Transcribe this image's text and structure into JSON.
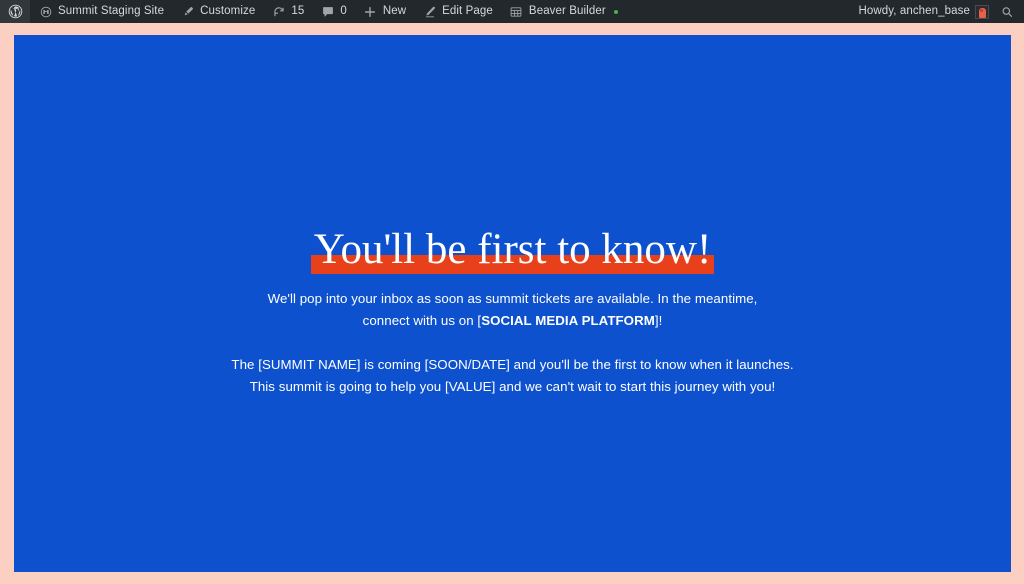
{
  "colors": {
    "page_background": "#fbcfc2",
    "canvas_blue": "#0d51ce",
    "highlight_orange": "#e8401a",
    "adminbar_background": "#23282d",
    "adminbar_text": "#d4d9dd",
    "text_white": "#ffffff",
    "bb_dot_green": "#4caf50"
  },
  "adminbar": {
    "left_items": [
      {
        "id": "wp-logo",
        "label": "",
        "icon": "wordpress-logo-icon"
      },
      {
        "id": "site-name",
        "label": "Summit Staging Site",
        "icon": "site-home-icon"
      },
      {
        "id": "customize",
        "label": "Customize",
        "icon": "paintbrush-icon"
      },
      {
        "id": "updates",
        "label": "15",
        "icon": "update-arrows-icon"
      },
      {
        "id": "comments",
        "label": "0",
        "icon": "comment-bubble-icon"
      },
      {
        "id": "new-content",
        "label": "New",
        "icon": "plus-icon"
      },
      {
        "id": "edit-page",
        "label": "Edit Page",
        "icon": "pencil-icon"
      },
      {
        "id": "beaver-builder",
        "label": "Beaver Builder",
        "icon": "grid-icon"
      }
    ],
    "right_items": [
      {
        "id": "my-account",
        "label": "Howdy, anchen_base",
        "icon": "user-avatar-icon"
      },
      {
        "id": "search",
        "label": "",
        "icon": "search-icon"
      }
    ]
  },
  "main": {
    "headline": "You'll be first to know!",
    "paragraph_1": {
      "before_bold": "We'll pop into your inbox as soon as summit tickets are available. In the meantime, connect with us on [",
      "bold": "SOCIAL MEDIA PLATFORM",
      "after_bold": "]!"
    },
    "paragraph_2_line_1": "The [SUMMIT NAME] is coming [SOON/DATE] and you'll be the first to know when it launches.",
    "paragraph_2_line_2": "This summit is going to help you [VALUE] and we can't wait to start this journey with you!"
  }
}
